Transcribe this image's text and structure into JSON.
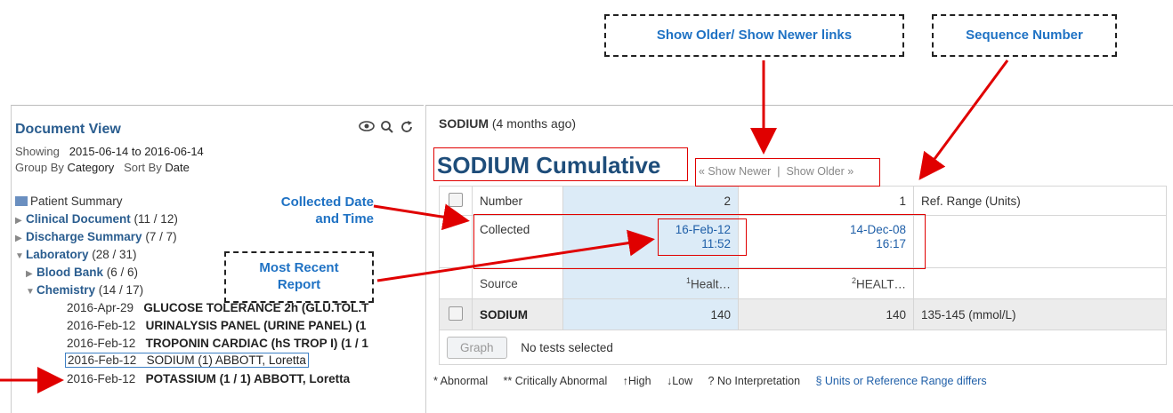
{
  "callouts": {
    "show_links": "Show Older/ Show Newer links",
    "sequence": "Sequence Number",
    "collected_line1": "Collected Date",
    "collected_line2": "and Time",
    "recent_line1": "Most Recent",
    "recent_line2": "Report"
  },
  "left": {
    "title": "Document View",
    "showing_label": "Showing",
    "showing_value": "2015-06-14 to 2016-06-14",
    "group_by_label": "Group By",
    "group_by_value": "Category",
    "sort_by_label": "Sort By",
    "sort_by_value": "Date",
    "tree": [
      {
        "label": "Patient Summary",
        "count": ""
      },
      {
        "label": "Clinical Document",
        "count": "(11 / 12)"
      },
      {
        "label": "Discharge Summary",
        "count": "(7 / 7)"
      },
      {
        "label": "Laboratory",
        "count": "(28 / 31)"
      },
      {
        "label": "Blood Bank",
        "count": "(6 / 6)"
      },
      {
        "label": "Chemistry",
        "count": "(14 / 17)"
      }
    ],
    "docs": [
      {
        "date": "2016-Apr-29",
        "name": "GLUCOSE TOLERANCE 2h (GLU.TOL.T"
      },
      {
        "date": "2016-Feb-12",
        "name": "URINALYSIS PANEL (URINE PANEL) (1"
      },
      {
        "date": "2016-Feb-12",
        "name": "TROPONIN CARDIAC (hS TROP I) (1 / 1"
      },
      {
        "date": "2016-Feb-12",
        "name": "SODIUM (1) ABBOTT, Loretta"
      },
      {
        "date": "2016-Feb-12",
        "name": "POTASSIUM (1 / 1) ABBOTT, Loretta"
      }
    ]
  },
  "right": {
    "header": "SODIUM (4 months ago)",
    "title": "SODIUM Cumulative",
    "show_newer": "« Show Newer",
    "separator": "|",
    "show_older": "Show Older »",
    "table": {
      "number_label": "Number",
      "seq1": "2",
      "seq2": "1",
      "ref_header": "Ref. Range (Units)",
      "collected_label": "Collected",
      "c1_date": "16-Feb-12",
      "c1_time": "11:52",
      "c2_date": "14-Dec-08",
      "c2_time": "16:17",
      "source_label": "Source",
      "s1_sup": "1",
      "s1": "Healt…",
      "s2_sup": "2",
      "s2": "HEALT…",
      "test_name": "SODIUM",
      "v1": "140",
      "v2": "140",
      "ref_range": "135-145 (mmol/L)"
    },
    "graph_button": "Graph",
    "no_tests": "No tests selected",
    "legend": {
      "abnormal": "* Abnormal",
      "critical": "** Critically Abnormal",
      "high": "High",
      "low": "Low",
      "no_interp": "? No Interpretation",
      "units": "§ Units or Reference Range differs"
    }
  },
  "colors": {
    "accent_blue": "#1f72c4",
    "annotation_red": "#e00000",
    "title_blue": "#1e4d7a"
  }
}
